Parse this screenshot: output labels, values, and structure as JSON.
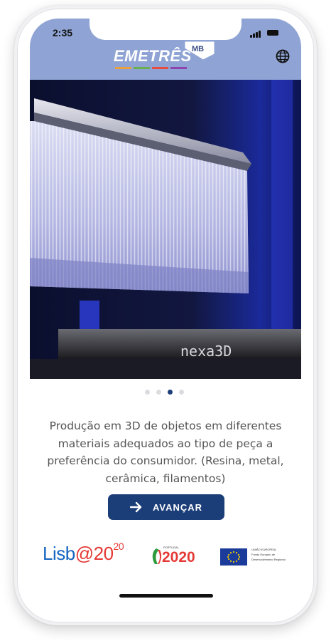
{
  "status_bar": {
    "time": "2:35"
  },
  "header": {
    "logo_text": "EMETRÊS",
    "logo_mark_text": "MB",
    "logo_bar_colors": [
      "#e8a13a",
      "#6ab04c",
      "#e74c3c",
      "#8e44ad"
    ],
    "globe_icon": "globe-icon",
    "background_color": "#8fa4d4"
  },
  "hero": {
    "printer_brand": "nexa3D",
    "icon": "3d-printer-photo"
  },
  "carousel": {
    "page_count": 4,
    "active_index": 2
  },
  "description": "Produção em 3D de objetos em diferentes materiais adequados ao tipo de peça a preferência do consumidor. (Resina, metal, cerâmica, filamentos)",
  "next_button": {
    "label": "AVANÇAR",
    "icon": "arrow-right-icon",
    "color": "#1b3d78"
  },
  "sponsors": {
    "lisboa": {
      "prefix": "Lisb",
      "at": "@",
      "number": "20",
      "sup": "20"
    },
    "portugal2020": {
      "small_label": "PORTUGAL",
      "year": "2020"
    },
    "eu": {
      "small_label": "UNIÃO EUROPEIA",
      "fund_label": "Fundo Europeu de Desenvolvimento Regional"
    }
  }
}
